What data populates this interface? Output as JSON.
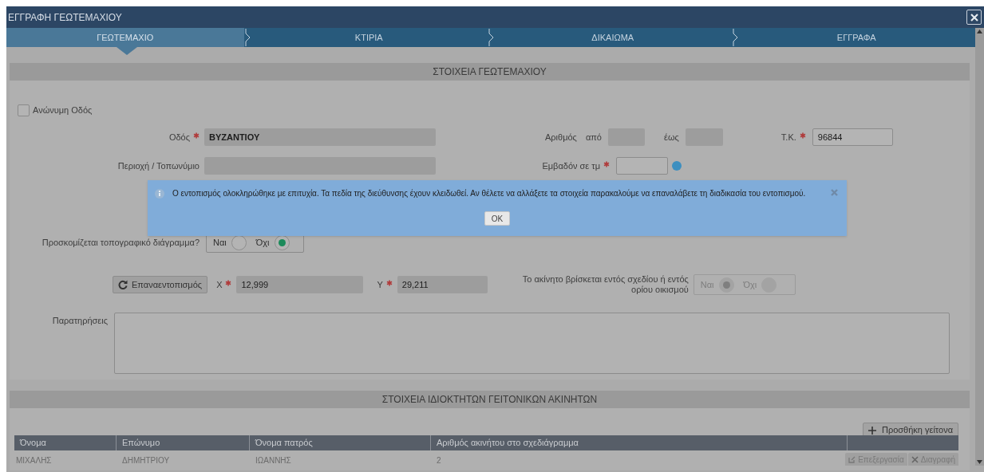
{
  "window": {
    "title": "ΕΓΓΡΑΦΗ ΓΕΩΤΕΜΑΧΙΟΥ"
  },
  "tabs": [
    {
      "label": "ΓΕΩΤΕΜΑΧΙΟ",
      "selected": true
    },
    {
      "label": "ΚΤΙΡΙΑ",
      "selected": false
    },
    {
      "label": "ΔΙΚΑΙΩΜΑ",
      "selected": false
    },
    {
      "label": "ΕΓΓΡΑΦΑ",
      "selected": false
    }
  ],
  "parcel_section": {
    "title": "ΣΤΟΙΧΕΙΑ ΓΕΩΤΕΜΑΧΙΟΥ",
    "anonymous_street": {
      "label": "Ανώνυμη Οδός",
      "checked": false
    },
    "street": {
      "label": "Οδός",
      "required": true,
      "value": "ΒΥΖΑΝΤΙΟΥ"
    },
    "number": {
      "label": "Αριθμός",
      "from_label": "από",
      "to_label": "έως"
    },
    "postal_code": {
      "label": "Τ.Κ.",
      "required": true,
      "value": "96844"
    },
    "locality": {
      "label": "Περιοχή / Τοπωνύμιο"
    },
    "area_sqm": {
      "label": "Εμβαδόν σε τμ",
      "required": true
    },
    "topographic": {
      "label": "Προσκομίζεται τοπογραφικό διάγραμμα?",
      "options": [
        {
          "label": "Ναι",
          "selected": false
        },
        {
          "label": "Όχι",
          "selected": true
        }
      ]
    },
    "relocate_button": "Επαναεντοπισμός",
    "x": {
      "label": "X",
      "required": true,
      "value": "12,999"
    },
    "y": {
      "label": "Y",
      "required": true,
      "value": "29,211"
    },
    "within_plan": {
      "label": "Το ακίνητο βρίσκεται εντός σχεδίου ή εντός ορίου οικισμού",
      "disabled": true,
      "options": [
        {
          "label": "Ναι",
          "selected": true
        },
        {
          "label": "Όχι",
          "selected": false
        }
      ]
    },
    "notes": {
      "label": "Παρατηρήσεις"
    }
  },
  "neighbors_section": {
    "title": "ΣΤΟΙΧΕΙΑ ΙΔΙΟΚΤΗΤΩΝ ΓΕΙΤΟΝΙΚΩΝ ΑΚΙΝΗΤΩΝ",
    "add_button": "Προσθήκη γείτονα",
    "table": {
      "columns": [
        "Όνομα",
        "Επώνυμο",
        "Όνομα πατρός",
        "Αριθμός ακινήτου στο σχεδιάγραμμα"
      ],
      "rows": [
        {
          "cells": [
            "ΜΙΧΑΛΗΣ",
            "ΔΗΜΗΤΡΙΟΥ",
            "ΙΩΑΝΝΗΣ",
            "2"
          ],
          "actions": [
            {
              "kind": "edit",
              "label": "Επεξεργασία"
            },
            {
              "kind": "delete",
              "label": "Διαγραφή"
            }
          ]
        }
      ]
    }
  },
  "alert": {
    "message": "Ο εντοπισμός ολοκληρώθηκε με επιτυχία. Τα πεδία της διεύθυνσης έχουν κλειδωθεί. Αν θέλετε να αλλάξετε τα στοιχεία παρακαλούμε να επαναλάβετε τη διαδικασία του εντοπισμού.",
    "button": "OK"
  }
}
